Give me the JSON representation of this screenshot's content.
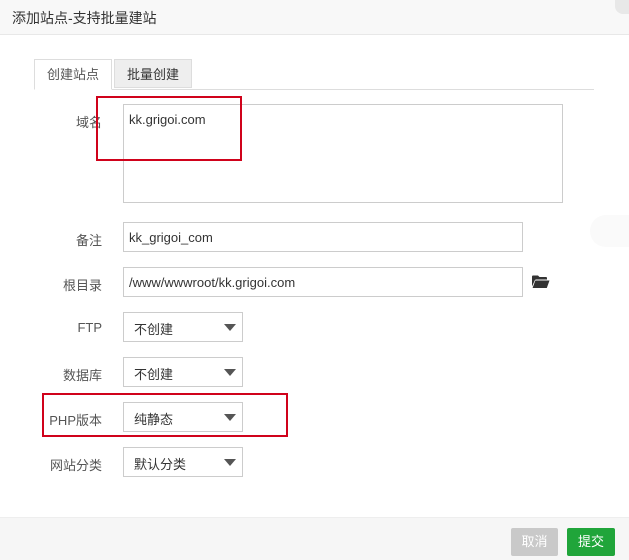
{
  "dialog": {
    "title": "添加站点-支持批量建站"
  },
  "tabs": [
    {
      "label": "创建站点",
      "active": true
    },
    {
      "label": "批量创建",
      "active": false
    }
  ],
  "form": {
    "domain": {
      "label": "域名",
      "value": "kk.grigoi.com"
    },
    "remark": {
      "label": "备注",
      "value": "kk_grigoi_com"
    },
    "root": {
      "label": "根目录",
      "value": "/www/wwwroot/kk.grigoi.com",
      "icon": "folder-open-icon"
    },
    "ftp": {
      "label": "FTP",
      "value": "不创建"
    },
    "database": {
      "label": "数据库",
      "value": "不创建"
    },
    "php": {
      "label": "PHP版本",
      "value": "纯静态"
    },
    "category": {
      "label": "网站分类",
      "value": "默认分类"
    }
  },
  "footer": {
    "cancel_label": "取消",
    "submit_label": "提交"
  },
  "colors": {
    "submit": "#20a53a",
    "cancel": "#c9c9c9",
    "annotation": "#d0021b"
  }
}
